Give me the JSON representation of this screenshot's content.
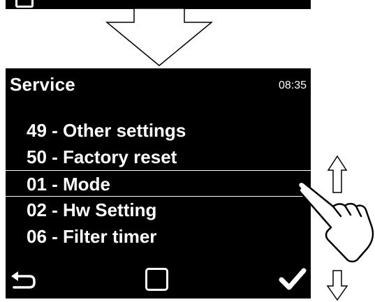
{
  "screen": {
    "title": "Service",
    "clock": "08:35",
    "menu_items": [
      {
        "label": "49 - Other settings",
        "selected": false
      },
      {
        "label": "50 - Factory reset",
        "selected": false
      },
      {
        "label": "01 - Mode",
        "selected": true
      },
      {
        "label": "02 - Hw Setting",
        "selected": false
      },
      {
        "label": "06 - Filter timer",
        "selected": false
      }
    ]
  },
  "footer": {
    "back_icon": "return-arrow-icon",
    "center_icon": "square-icon",
    "confirm_icon": "checkmark-icon"
  },
  "annotations": {
    "transition_arrow_icon": "down-arrow-icon",
    "scroll_up_icon": "up-arrow-icon",
    "scroll_down_icon": "down-arrow-icon",
    "gesture_icon": "hand-pointer-icon"
  },
  "colors": {
    "screen_background": "#000000",
    "screen_text": "#ffffff",
    "page_background": "#ffffff"
  }
}
